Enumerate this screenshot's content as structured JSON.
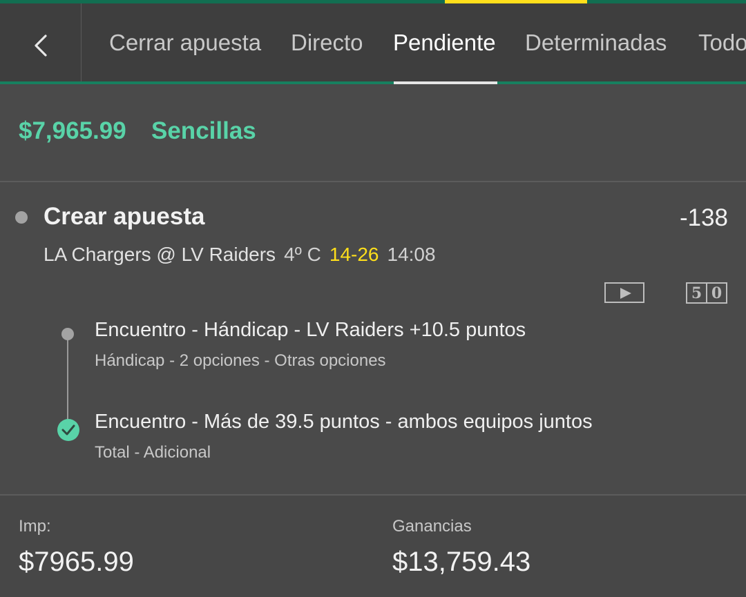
{
  "header": {
    "tabs": [
      {
        "label": "Cerrar apuesta",
        "active": false
      },
      {
        "label": "Directo",
        "active": false
      },
      {
        "label": "Pendiente",
        "active": true
      },
      {
        "label": "Determinadas",
        "active": false
      },
      {
        "label": "Todo",
        "active": false
      }
    ]
  },
  "summary": {
    "amount": "$7,965.99",
    "type": "Sencillas"
  },
  "bet": {
    "title": "Crear apuesta",
    "odds": "-138",
    "event": {
      "teams": "LA Chargers @ LV Raiders",
      "quarter": "4º C",
      "score": "14-26",
      "clock": "14:08"
    },
    "icons": {
      "video": "play-video-icon",
      "scoreboard_left": "5",
      "scoreboard_right": "0"
    },
    "legs": [
      {
        "title": "Encuentro - Hándicap - LV Raiders +10.5 puntos",
        "subtitle": "Hándicap - 2 opciones - Otras opciones",
        "status": "pending"
      },
      {
        "title": "Encuentro - Más de 39.5 puntos - ambos equipos juntos",
        "subtitle": "Total - Adicional",
        "status": "won"
      }
    ]
  },
  "footer": {
    "stake_label": "Imp:",
    "stake_value": "$7965.99",
    "returns_label": "Ganancias",
    "returns_value": "$13,759.43"
  },
  "colors": {
    "accent_green": "#59d3a8",
    "brand_green": "#126e51",
    "brand_yellow": "#ffdf1b",
    "background": "#4a4a4a"
  }
}
